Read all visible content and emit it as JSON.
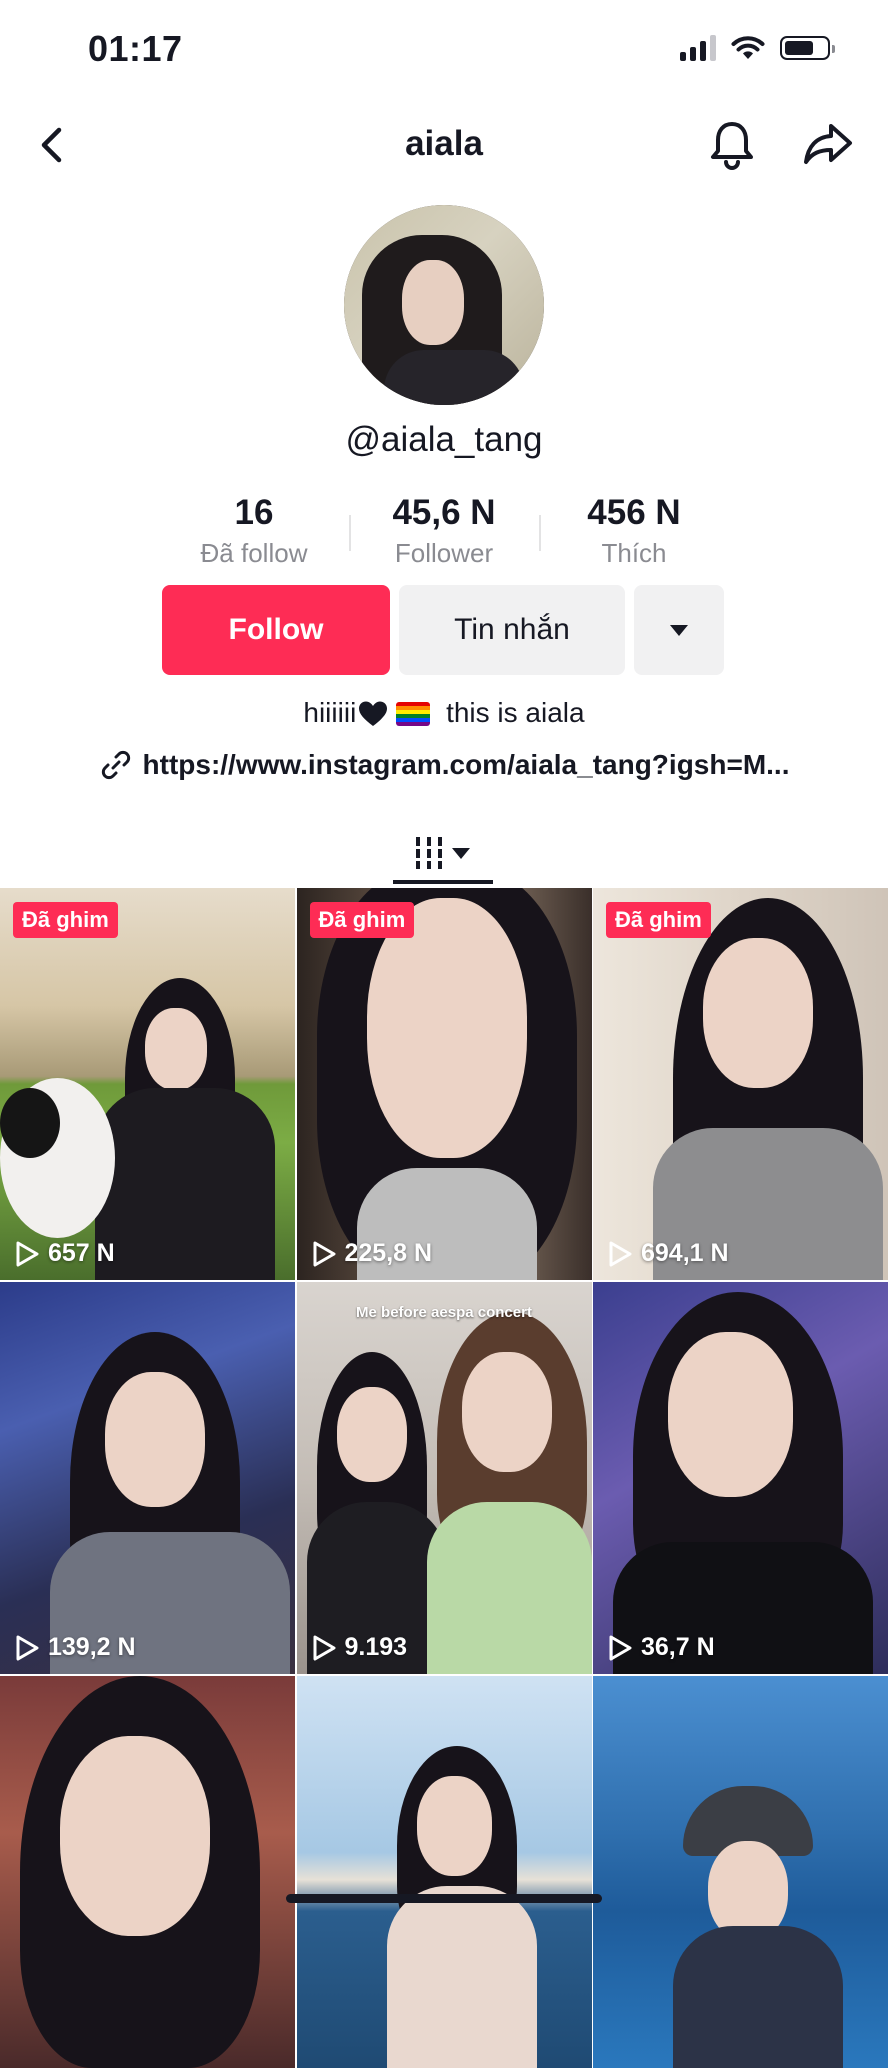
{
  "status_bar": {
    "time": "01:17"
  },
  "nav": {
    "title": "aiala"
  },
  "profile": {
    "handle": "@aiala_tang",
    "stats": [
      {
        "value": "16",
        "label": "Đã follow"
      },
      {
        "value": "45,6 N",
        "label": "Follower"
      },
      {
        "value": "456 N",
        "label": "Thích"
      }
    ],
    "buttons": {
      "follow": "Follow",
      "message": "Tin nhắn"
    },
    "bio_text_before": "hiiiiii",
    "bio_text_after": " this is aiala",
    "link": "https://www.instagram.com/aiala_tang?igsh=M..."
  },
  "grid": {
    "tiles": [
      {
        "pinned_label": "Đã ghim",
        "views": "657 N"
      },
      {
        "pinned_label": "Đã ghim",
        "views": "225,8 N"
      },
      {
        "pinned_label": "Đã ghim",
        "views": "694,1 N"
      },
      {
        "views": "139,2 N"
      },
      {
        "views": "9.193",
        "caption": "Me before aespa concert"
      },
      {
        "views": "36,7 N"
      },
      {},
      {},
      {}
    ]
  },
  "colors": {
    "accent": "#fe2c55",
    "text": "#161823",
    "muted": "#8a8b91",
    "button_gray": "#f1f1f2"
  },
  "icons": [
    "back-chevron-icon",
    "bell-icon",
    "share-arrow-icon",
    "link-icon",
    "grid-icon",
    "play-icon"
  ]
}
